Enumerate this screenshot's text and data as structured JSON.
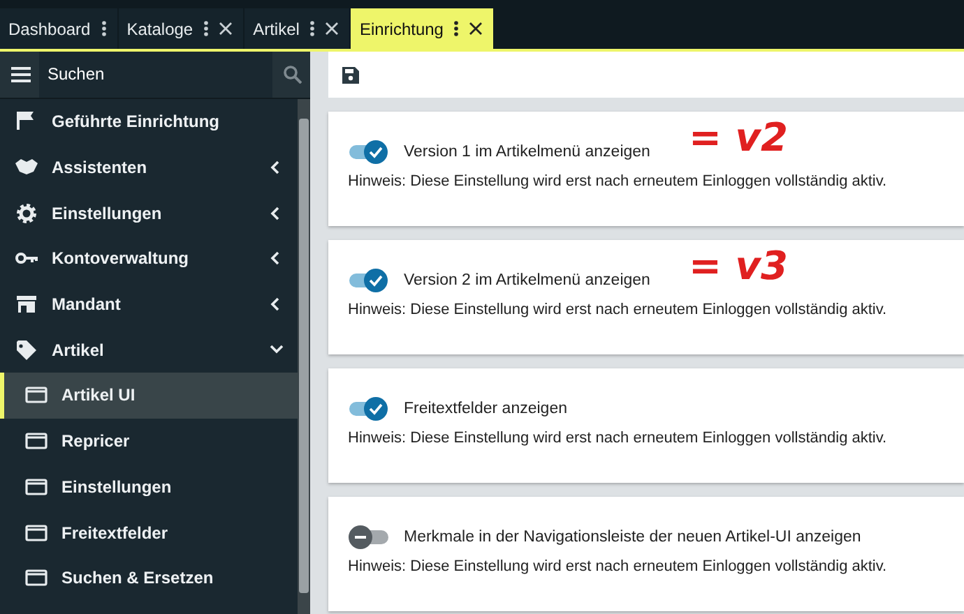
{
  "tabs": [
    {
      "label": "Dashboard",
      "selected": false,
      "closable": false
    },
    {
      "label": "Kataloge",
      "selected": false,
      "closable": true
    },
    {
      "label": "Artikel",
      "selected": false,
      "closable": true
    },
    {
      "label": "Einrichtung",
      "selected": true,
      "closable": true
    }
  ],
  "sidebar": {
    "search": {
      "placeholder": "Suchen"
    },
    "items": [
      {
        "kind": "link",
        "label": "Geführte Einrichtung"
      },
      {
        "kind": "group",
        "label": "Assistenten",
        "expanded": false
      },
      {
        "kind": "group",
        "label": "Einstellungen",
        "expanded": false
      },
      {
        "kind": "group",
        "label": "Kontoverwaltung",
        "expanded": false
      },
      {
        "kind": "group",
        "label": "Mandant",
        "expanded": false
      },
      {
        "kind": "group",
        "label": "Artikel",
        "expanded": true,
        "children": [
          {
            "label": "Artikel UI",
            "selected": true
          },
          {
            "label": "Repricer",
            "selected": false
          },
          {
            "label": "Einstellungen",
            "selected": false
          },
          {
            "label": "Freitextfelder",
            "selected": false
          },
          {
            "label": "Suchen & Ersetzen",
            "selected": false
          }
        ]
      }
    ]
  },
  "settings": [
    {
      "label": "Version 1 im Artikelmenü anzeigen",
      "on": true,
      "hint": "Hinweis: Diese Einstellung wird erst nach erneutem Einloggen vollständig aktiv.",
      "annotation": "= v2"
    },
    {
      "label": "Version 2 im Artikelmenü anzeigen",
      "on": true,
      "hint": "Hinweis: Diese Einstellung wird erst nach erneutem Einloggen vollständig aktiv.",
      "annotation": "= v3"
    },
    {
      "label": "Freitextfelder anzeigen",
      "on": true,
      "hint": "Hinweis: Diese Einstellung wird erst nach erneutem Einloggen vollständig aktiv."
    },
    {
      "label": "Merkmale in der Navigationsleiste der neuen Artikel-UI anzeigen",
      "on": false,
      "hint": "Hinweis: Diese Einstellung wird erst nach erneutem Einloggen vollständig aktiv."
    }
  ]
}
